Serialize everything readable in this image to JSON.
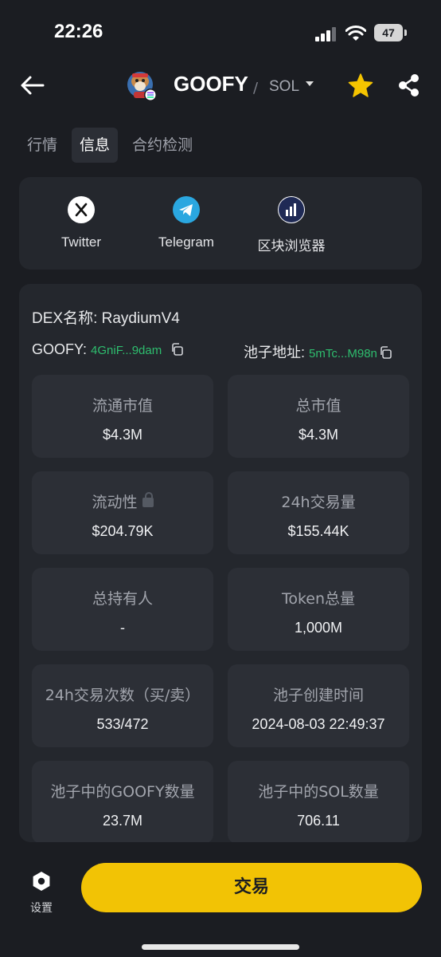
{
  "status": {
    "time": "22:26",
    "battery": "47"
  },
  "header": {
    "title": "GOOFY",
    "separator": "/",
    "chain": "SOL"
  },
  "tabs": [
    {
      "label": "行情"
    },
    {
      "label": "信息"
    },
    {
      "label": "合约检测"
    }
  ],
  "links": [
    {
      "label": "Twitter",
      "icon": "x-icon"
    },
    {
      "label": "Telegram",
      "icon": "telegram-icon"
    },
    {
      "label": "区块浏览器",
      "icon": "explorer-icon"
    }
  ],
  "info": {
    "dex_label": "DEX名称: RaydiumV4",
    "token_addr_label": "GOOFY:",
    "token_addr": "4GniF...9dam",
    "pool_addr_label": "池子地址:",
    "pool_addr": "5mTc...M98n"
  },
  "stats": [
    {
      "label": "流通市值",
      "value": "$4.3M"
    },
    {
      "label": "总市值",
      "value": "$4.3M"
    },
    {
      "label": "流动性",
      "value": "$204.79K"
    },
    {
      "label": "24h交易量",
      "value": "$155.44K"
    },
    {
      "label": "总持有人",
      "value": "-"
    },
    {
      "label": "Token总量",
      "value": "1,000M"
    },
    {
      "label": "24h交易次数（买/卖）",
      "value": "533/472"
    },
    {
      "label": "池子创建时间",
      "value": "2024-08-03 22:49:37"
    },
    {
      "label": "池子中的GOOFY数量",
      "value": "23.7M"
    },
    {
      "label": "池子中的SOL数量",
      "value": "706.11"
    }
  ],
  "bottom": {
    "settings_label": "设置",
    "trade_label": "交易"
  },
  "colors": {
    "accent": "#f2c305",
    "address_green": "#2ebd6e",
    "background": "#1b1d22",
    "card": "#24272d"
  }
}
